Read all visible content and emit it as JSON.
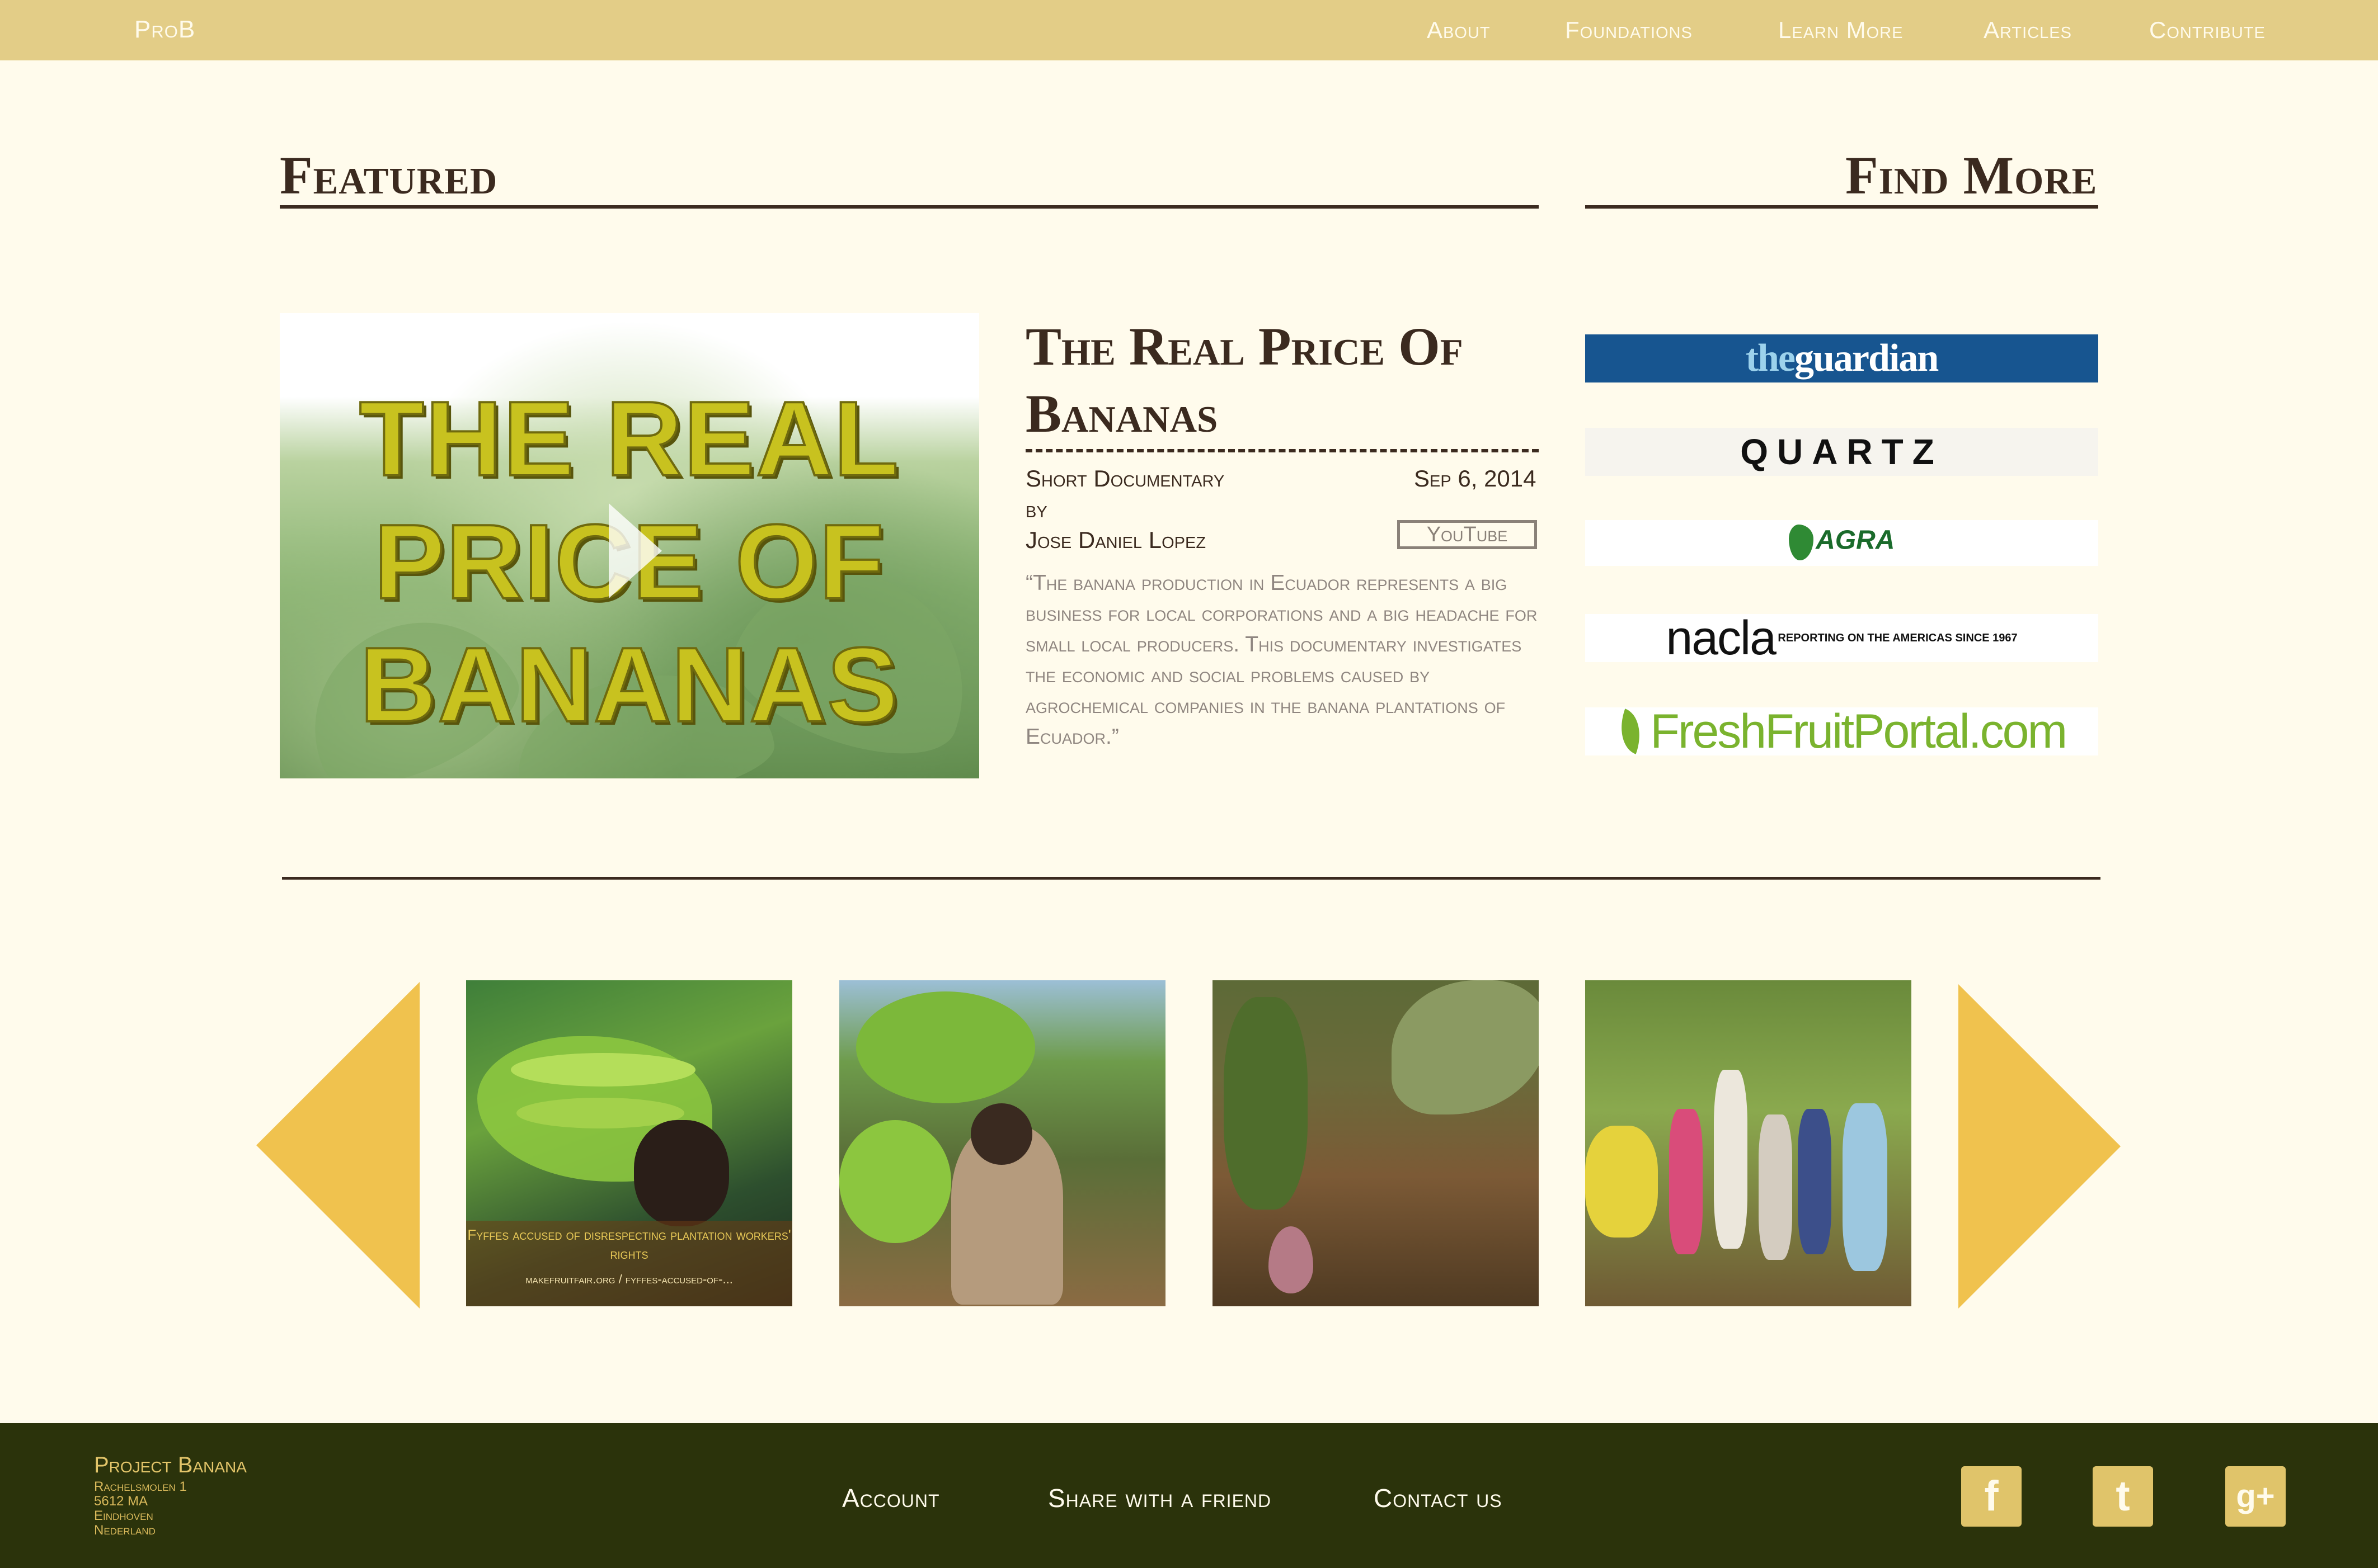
{
  "topnav": {
    "brand": "ProB",
    "links": [
      "About",
      "Foundations",
      "Learn More",
      "Articles",
      "Contribute"
    ]
  },
  "featured": {
    "heading": "Featured",
    "thumbnail_text": [
      "THE REAL",
      "PRICE OF",
      "BANANAS"
    ],
    "title_line1": "The Real Price Of",
    "title_line2": "Bananas",
    "type": "Short Documentary",
    "date": "Sep 6, 2014",
    "by": "by",
    "author": "Jose Daniel Lopez",
    "source_button": "YouTube",
    "description": "“The banana production in Ecuador represents a big business for local corporations and a big headache for small local producers. This documentary investigates the economic and social problems caused by agrochemical companies in the banana plantations of Ecuador.”"
  },
  "find_more": {
    "heading": "Find More",
    "logos": {
      "guardian_a": "the",
      "guardian_b": "guardian",
      "quartz": "QUARTZ",
      "agra": "AGRA",
      "nacla": "nacla",
      "nacla_tag": "REPORTING ON THE AMERICAS SINCE 1967",
      "freshfruit": "FreshFruitPortal.com"
    }
  },
  "carousel": {
    "cards": [
      {
        "caption": "Fyffes accused of disrespecting plantation workers' rights",
        "link": "makefruitfair.org / fyffes-accused-of-..."
      }
    ]
  },
  "footer": {
    "brand": "Project Banana",
    "address": [
      "Rachelsmolen 1",
      "5612 MA",
      "Eindhoven",
      "Nederland"
    ],
    "links": [
      "Account",
      "Share with a friend",
      "Contact us"
    ],
    "social": [
      "f",
      "t",
      "g+"
    ]
  },
  "colors": {
    "nav_bg": "#e3cd87",
    "page_bg": "#fffbec",
    "heading": "#3b2a1f",
    "accent_yellow": "#f0c24e",
    "footer_bg": "#2b330b"
  }
}
